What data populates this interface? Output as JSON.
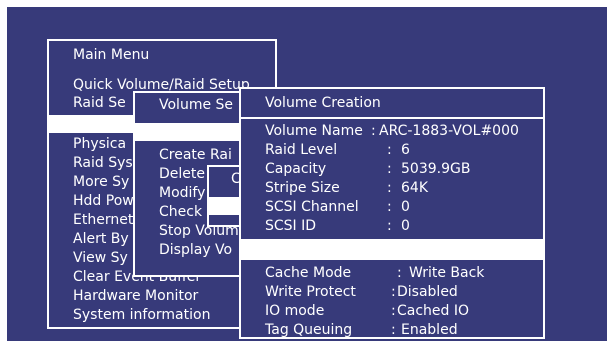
{
  "main_menu": {
    "title": "Main Menu",
    "items": [
      "Quick Volume/Raid Setup",
      "Raid Se",
      "",
      "Physica",
      "Raid Sys",
      "More Sy",
      "Hdd Pow",
      "Ethernet",
      "Alert By",
      "View Sy",
      "Clear Event Buffer",
      "Hardware Monitor",
      "System information"
    ]
  },
  "volume_set_menu": {
    "title": "Volume Se",
    "items": [
      "Create Rai",
      "Delete",
      "Modify",
      "Check",
      "Stop Volum",
      "Display Vo"
    ]
  },
  "small_box": {
    "label": "C"
  },
  "volume_creation": {
    "title": "Volume Creation",
    "fields": [
      {
        "key": "Volume Name",
        "sep": ":",
        "value": "ARC-1883-VOL#000"
      },
      {
        "key": "Raid Level",
        "sep": ":",
        "value": "6"
      },
      {
        "key": "Capacity",
        "sep": ":",
        "value": "5039.9GB"
      },
      {
        "key": "Stripe Size",
        "sep": ":",
        "value": "64K"
      },
      {
        "key": "SCSI  Channel",
        "sep": ":",
        "value": "0"
      },
      {
        "key": "SCSI  ID",
        "sep": ":",
        "value": "0"
      },
      {
        "key": "",
        "sep": "",
        "value": ""
      },
      {
        "key": "Cache Mode",
        "sep": ":",
        "value": "Write Back"
      },
      {
        "key": "Write Protect",
        "sep": ":",
        "value": "Disabled"
      },
      {
        "key": "IO mode",
        "sep": ":",
        "value": "Cached IO"
      },
      {
        "key": "Tag Queuing",
        "sep": ":",
        "value": "Enabled"
      }
    ]
  },
  "colors": {
    "background": "#373a7a",
    "foreground": "#ffffff",
    "highlight": "#ffffff"
  }
}
